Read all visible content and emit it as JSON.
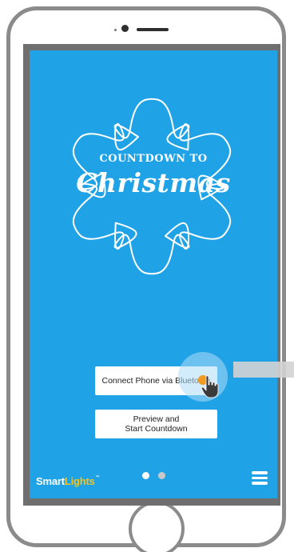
{
  "app": {
    "title_top": "COUNTDOWN TO",
    "title_main": "Christmas"
  },
  "buttons": {
    "connect_label": "Connect Phone via Bluetooth",
    "preview_label_line1": "Preview and",
    "preview_label_line2": "Start Countdown"
  },
  "footer": {
    "logo_part1": "Smart",
    "logo_part2": "Lights",
    "logo_mark": "™",
    "pagination": {
      "current": 1,
      "total": 2
    }
  },
  "icons": {
    "snowflake": "snowflake-outline-icon",
    "menu": "hamburger-menu-icon",
    "cursor": "pointing-hand-icon"
  },
  "colors": {
    "screen_background": "#1fa3e6",
    "logo_accent": "#f6c21c",
    "touch_indicator": "#f29a1f",
    "frame": "#8b8b8b"
  }
}
